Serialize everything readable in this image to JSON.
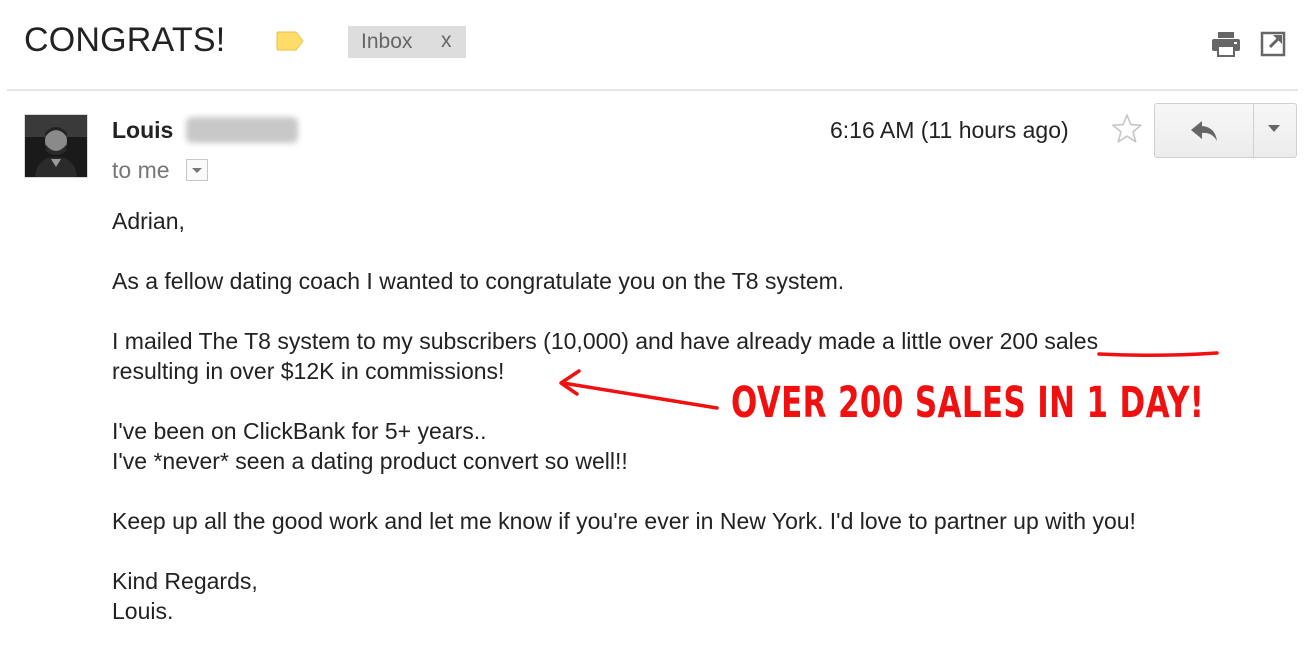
{
  "email": {
    "subject": "CONGRATS!",
    "label_chip": "Inbox",
    "label_chip_remove": "x",
    "label_color": "#fddc69"
  },
  "header": {
    "sender_name": "Louis",
    "recipient": "to me",
    "timestamp": "6:16 AM (11 hours ago)"
  },
  "body": {
    "greeting": "Adrian,",
    "para1": "As a fellow dating coach I wanted to congratulate you on the T8 system.",
    "para2_line1": "I mailed The T8 system to my subscribers (10,000) and have already made a little over 200 sales",
    "para2_line2": "resulting in over $12K in commissions!",
    "para3_line1": "I've been on ClickBank for 5+ years..",
    "para3_line2": "I've *never* seen a dating product convert so well!!",
    "para4": "Keep up all the good work and let me know if you're ever in New York. I'd love to partner up with you!",
    "signoff_line1": "Kind Regards,",
    "signoff_line2": "Louis."
  },
  "annotation": {
    "callout": "OVER 200 SALES IN 1 DAY!",
    "color": "#f01010"
  },
  "icons": {
    "print": "print-icon",
    "new_window": "new-window-icon",
    "star": "star-icon",
    "reply": "reply-icon",
    "more": "chevron-down-icon",
    "label": "label-icon"
  }
}
